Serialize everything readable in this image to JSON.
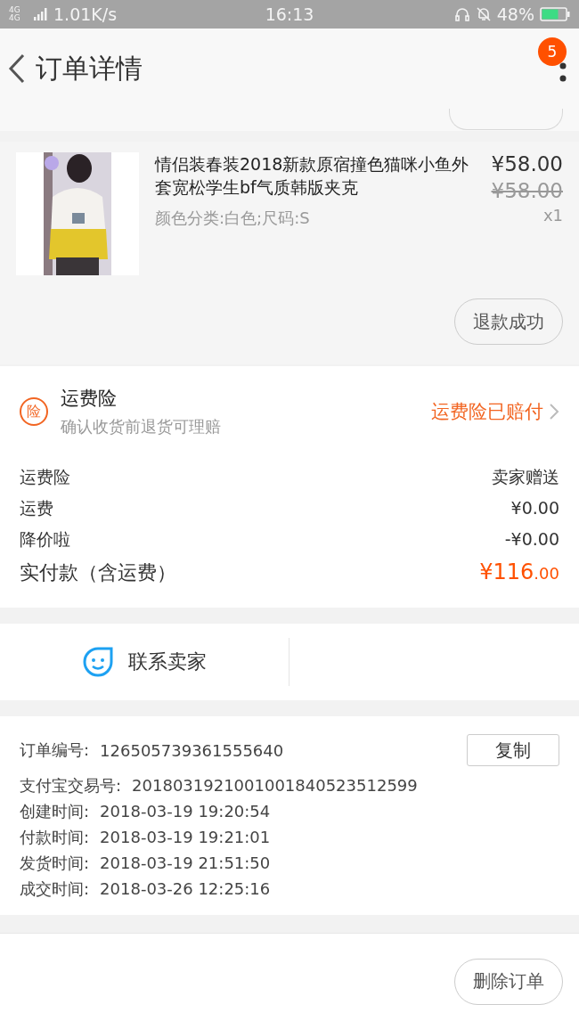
{
  "status_bar": {
    "network": "4G 4G",
    "speed": "1.01K/s",
    "time": "16:13",
    "battery": "48%"
  },
  "header": {
    "title": "订单详情",
    "badge": "5"
  },
  "product": {
    "title": "情侣装春装2018新款原宿撞色猫咪小鱼外套宽松学生bf气质韩版夹克",
    "sku": "颜色分类:白色;尺码:S",
    "price": "¥58.00",
    "original_price": "¥58.00",
    "quantity": "x1",
    "status_button": "退款成功"
  },
  "insurance": {
    "icon": "险",
    "title": "运费险",
    "subtitle": "确认收货前退货可理赔",
    "status": "运费险已赔付"
  },
  "summary": [
    {
      "label": "运费险",
      "value": "卖家赠送",
      "kind": "plain"
    },
    {
      "label": "运费",
      "value": "¥0.00",
      "kind": "plain"
    },
    {
      "label": "降价啦",
      "value": "-¥0.00",
      "kind": "plain"
    },
    {
      "label": "实付款（含运费）",
      "value": "¥116",
      "decimals": ".00",
      "kind": "total"
    }
  ],
  "contact": {
    "label": "联系卖家"
  },
  "order_info": {
    "copy_button": "复制",
    "rows": [
      {
        "label": "订单编号:",
        "value": "126505739361555640"
      },
      {
        "label": "支付宝交易号:",
        "value": "2018031921001001840523512599"
      },
      {
        "label": "创建时间:",
        "value": "2018-03-19 19:20:54"
      },
      {
        "label": "付款时间:",
        "value": "2018-03-19 19:21:01"
      },
      {
        "label": "发货时间:",
        "value": "2018-03-19 21:51:50"
      },
      {
        "label": "成交时间:",
        "value": "2018-03-26 12:25:16"
      }
    ]
  },
  "bottom_bar": {
    "button": "删除订单"
  }
}
